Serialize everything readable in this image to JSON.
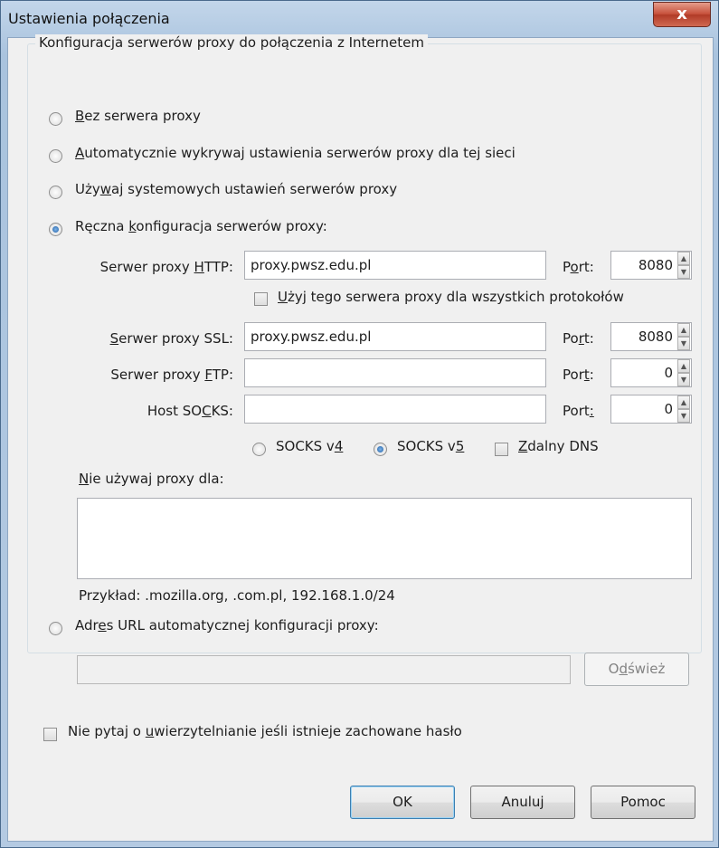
{
  "window": {
    "title": "Ustawienia połączenia",
    "close_label": "x"
  },
  "group": {
    "legend": "Konfiguracja serwerów proxy do połączenia z Internetem"
  },
  "options": {
    "no_proxy": {
      "pre": "",
      "key": "B",
      "post": "ez serwera proxy",
      "checked": false
    },
    "auto_detect": {
      "pre": "",
      "key": "A",
      "post": "utomatycznie wykrywaj ustawienia serwerów proxy dla tej sieci",
      "checked": false
    },
    "system": {
      "pre": "Uży",
      "key": "w",
      "post": "aj systemowych ustawień serwerów proxy",
      "checked": false
    },
    "manual": {
      "pre": "Ręczna ",
      "key": "k",
      "post": "onfiguracja serwerów proxy:",
      "checked": true
    },
    "auto_url": {
      "pre": "Adr",
      "key": "e",
      "post": "s URL automatycznej konfiguracji proxy:",
      "checked": false
    }
  },
  "http": {
    "label_pre": "Serwer proxy ",
    "label_key": "H",
    "label_post": "TTP:",
    "value": "proxy.pwsz.edu.pl",
    "port_pre": "P",
    "port_key": "o",
    "port_post": "rt:",
    "port": "8080"
  },
  "share": {
    "pre": "",
    "key": "U",
    "post": "żyj tego serwera proxy dla wszystkich protokołów",
    "checked": false
  },
  "ssl": {
    "label_pre": "",
    "label_key": "S",
    "label_post": "erwer proxy SSL:",
    "value": "proxy.pwsz.edu.pl",
    "port_pre": "Po",
    "port_key": "r",
    "port_post": "t:",
    "port": "8080"
  },
  "ftp": {
    "label_pre": "Serwer proxy ",
    "label_key": "F",
    "label_post": "TP:",
    "value": "",
    "port_pre": "Por",
    "port_key": "t",
    "port_post": ":",
    "port": "0"
  },
  "socks": {
    "label_pre": "Host SO",
    "label_key": "C",
    "label_post": "KS:",
    "value": "",
    "port_pre": "Port",
    "port_key": ":",
    "port_post": "",
    "port": "0"
  },
  "socks_version": {
    "v4_pre": "SOCKS v",
    "v4_key": "4",
    "v4_checked": false,
    "v5_pre": "SOCKS v",
    "v5_key": "5",
    "v5_checked": true,
    "dns_pre": "",
    "dns_key": "Z",
    "dns_post": "dalny DNS",
    "dns_checked": false
  },
  "no_proxy_for": {
    "pre": "",
    "key": "N",
    "post": "ie używaj proxy dla:",
    "value": ""
  },
  "example": "Przykład: .mozilla.org, .com.pl, 192.168.1.0/24",
  "auto_url": {
    "value": "",
    "reload_pre": "O",
    "reload_key": "d",
    "reload_post": "śwież"
  },
  "no_prompt": {
    "pre": "Nie pytaj o ",
    "key": "u",
    "post": "wierzytelnianie jeśli istnieje zachowane hasło",
    "checked": false
  },
  "buttons": {
    "ok": "OK",
    "cancel": "Anuluj",
    "help": "Pomoc"
  }
}
